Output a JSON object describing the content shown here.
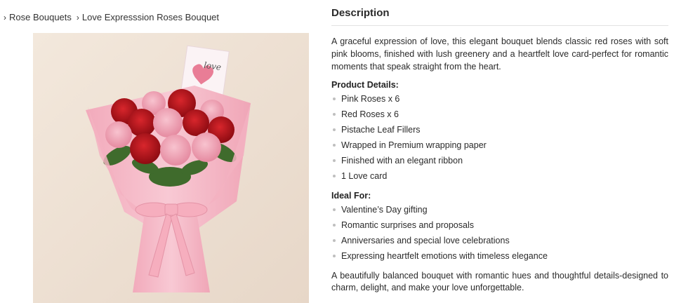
{
  "breadcrumb": {
    "items": [
      {
        "label": "Rose Bouquets"
      },
      {
        "label": "Love Expresssion Roses Bouquet"
      }
    ]
  },
  "product_image": {
    "card_text": "love"
  },
  "description": {
    "title": "Description",
    "intro": "A graceful expression of love, this elegant bouquet blends classic red roses with soft pink blooms, finished with lush greenery and a heartfelt love card-perfect for romantic moments that speak straight from the heart.",
    "product_details_heading": "Product Details:",
    "product_details": [
      "Pink Roses x 6",
      "Red Roses x 6",
      "Pistache Leaf Fillers",
      "Wrapped in Premium wrapping paper",
      "Finished with an elegant ribbon",
      "1 Love card"
    ],
    "ideal_for_heading": "Ideal For:",
    "ideal_for": [
      "Valentine’s Day gifting",
      "Romantic surprises and proposals",
      "Anniversaries and special love celebrations",
      "Expressing heartfelt emotions with timeless elegance"
    ],
    "outro": "A beautifully balanced bouquet with romantic hues and thoughtful details-designed to charm, delight, and make your love unforgettable."
  },
  "colors": {
    "background": "#ffffff",
    "photo_backdrop": "#efe3d6",
    "wrap_pink": "#f4b9c6",
    "red_rose": "#c0151c",
    "pink_rose": "#ef9fb2",
    "ribbon": "#f6aebe",
    "bullet": "#bfbfbf"
  },
  "icons": {
    "breadcrumb_separator": "chevron-right-icon"
  }
}
